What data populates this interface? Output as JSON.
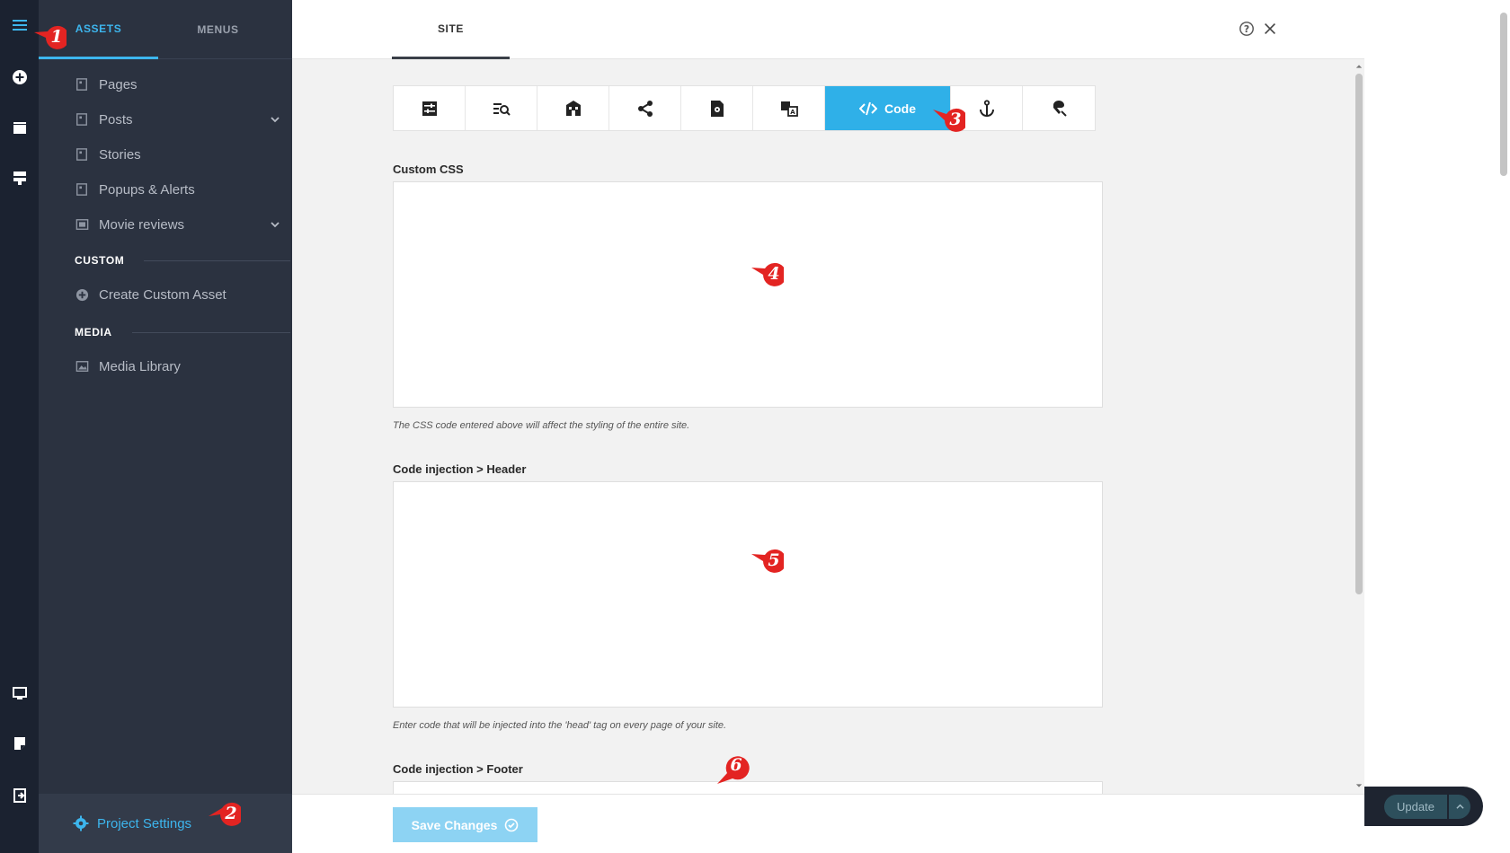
{
  "panel": {
    "tabs": [
      {
        "label": "ASSETS",
        "active": true
      },
      {
        "label": "MENUS",
        "active": false
      }
    ],
    "items": [
      {
        "label": "Pages",
        "icon": "page-icon",
        "has_chevron": false
      },
      {
        "label": "Posts",
        "icon": "page-icon",
        "has_chevron": true
      },
      {
        "label": "Stories",
        "icon": "page-icon",
        "has_chevron": false
      },
      {
        "label": "Popups & Alerts",
        "icon": "page-icon",
        "has_chevron": false
      },
      {
        "label": "Movie reviews",
        "icon": "collection-icon",
        "has_chevron": true
      }
    ],
    "sections": {
      "custom": "CUSTOM",
      "media": "MEDIA"
    },
    "create_custom": "Create Custom Asset",
    "media_library": "Media Library",
    "project_settings": "Project Settings"
  },
  "main": {
    "tab_site": "SITE",
    "toolbar": {
      "icons": [
        "general-settings-icon",
        "seo-icon",
        "organization-icon",
        "share-icon",
        "page-settings-icon",
        "translate-icon",
        "code-icon",
        "anchor-icon",
        "integrations-icon"
      ],
      "active_label": "Code"
    },
    "custom_css": {
      "label": "Custom CSS",
      "value": "",
      "hint": "The CSS code entered above will affect the styling of the entire site."
    },
    "header_code": {
      "label": "Code injection > Header",
      "value": "",
      "hint": "Enter code that will be injected into the 'head' tag on every page of your site."
    },
    "footer_code": {
      "label": "Code injection > Footer",
      "value": ""
    },
    "save_label": "Save Changes"
  },
  "update_label": "Update",
  "markers": [
    "1",
    "2",
    "3",
    "4",
    "5",
    "6"
  ],
  "colors": {
    "accent": "#2fb0e8",
    "rail": "#1b2230",
    "panel": "#2b3240",
    "marker": "#e32422"
  }
}
